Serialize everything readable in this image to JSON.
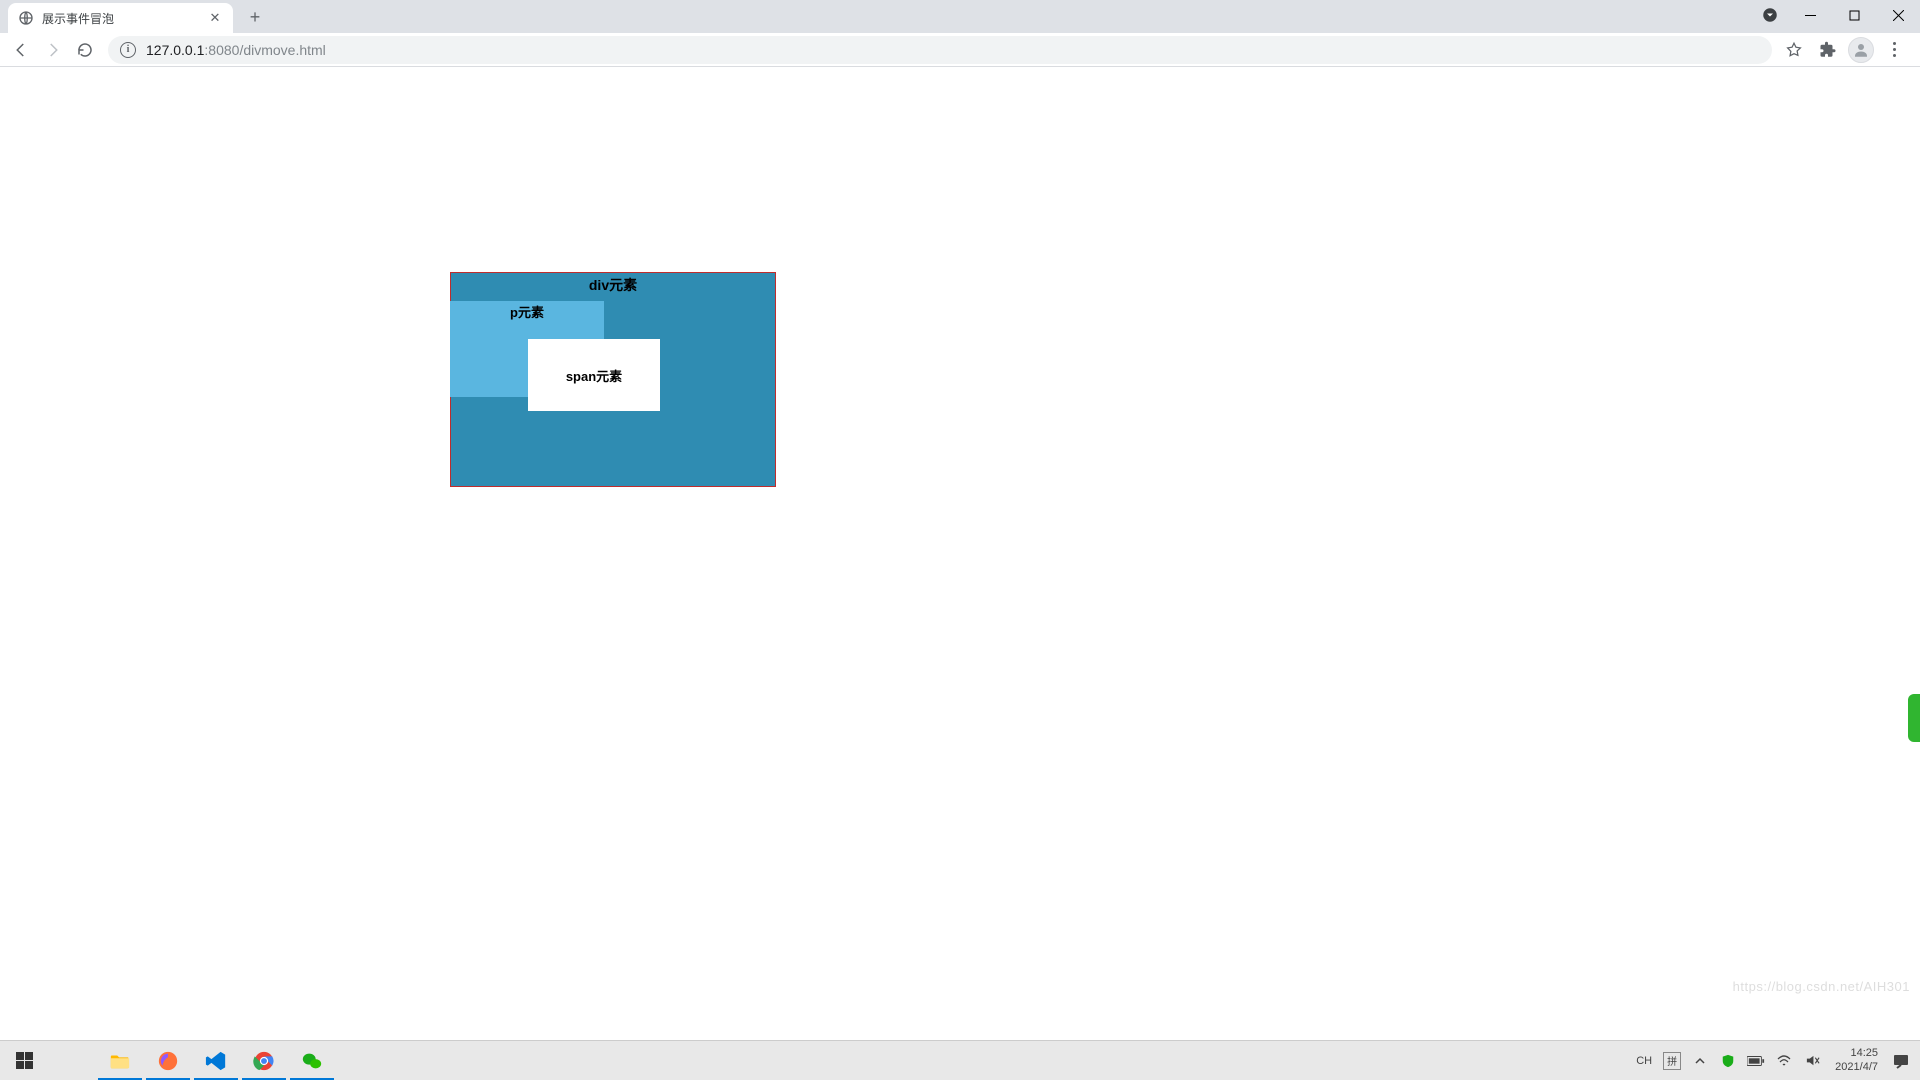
{
  "browser": {
    "tab_title": "展示事件冒泡",
    "url_host": "127.0.0.1",
    "url_port": ":8080",
    "url_path": "/divmove.html"
  },
  "page": {
    "div_label": "div元素",
    "p_label": "p元素",
    "span_label": "span元素"
  },
  "taskbar": {
    "ime_ch": "CH",
    "ime_pin": "拼",
    "time": "14:25",
    "date": "2021/4/7"
  },
  "watermark": "https://blog.csdn.net/AIH301"
}
